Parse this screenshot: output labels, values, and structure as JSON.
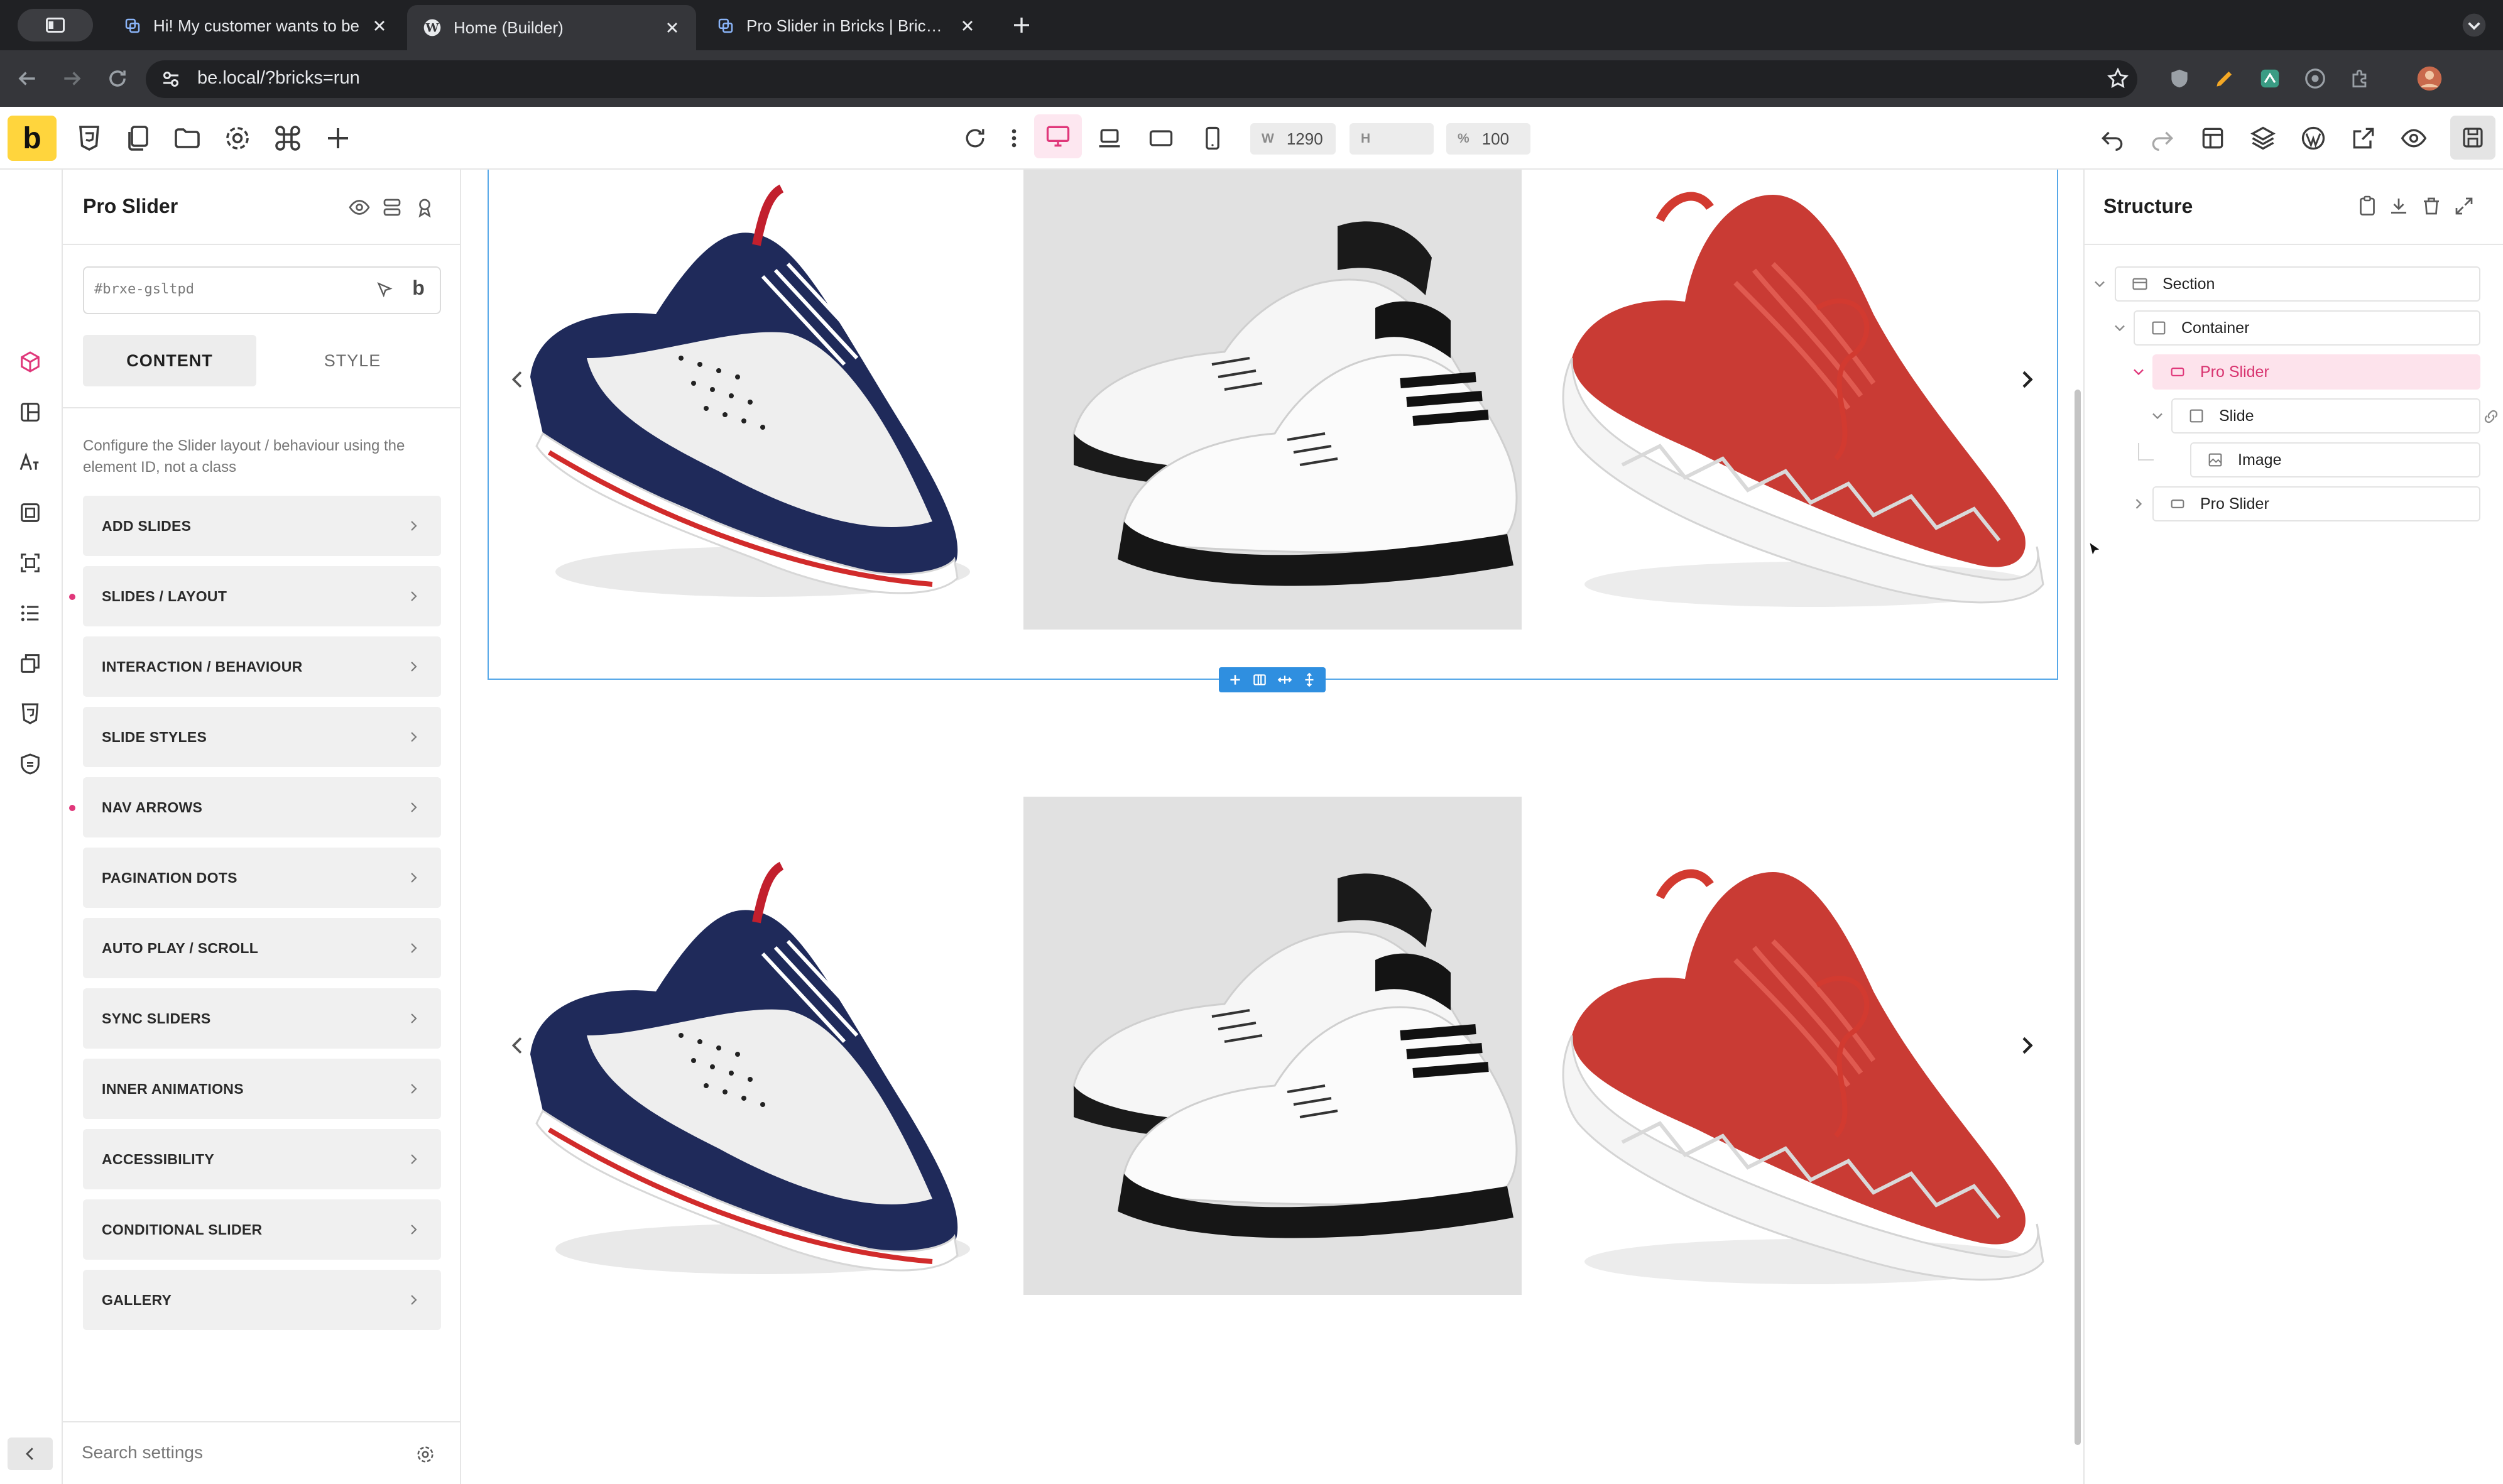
{
  "browser": {
    "tabs": [
      {
        "title": "Hi! My customer wants to be",
        "active": false
      },
      {
        "title": "Home (Builder)",
        "active": true
      },
      {
        "title": "Pro Slider in Bricks | BricksEx",
        "active": false
      }
    ],
    "url": "be.local/?bricks=run"
  },
  "toolbar": {
    "logo_letter": "b",
    "width_label": "W",
    "width_value": "1290",
    "height_label": "H",
    "height_value": "",
    "zoom_label": "%",
    "zoom_value": "100"
  },
  "panel": {
    "title": "Pro Slider",
    "element_id_placeholder": "#brxe-gsltpd",
    "tab_content": "CONTENT",
    "tab_style": "STYLE",
    "description": "Configure the Slider layout / behaviour using the element ID, not a class",
    "sections": [
      {
        "label": "ADD SLIDES",
        "modified": false
      },
      {
        "label": "SLIDES / LAYOUT",
        "modified": true
      },
      {
        "label": "INTERACTION / BEHAVIOUR",
        "modified": false
      },
      {
        "label": "SLIDE STYLES",
        "modified": false
      },
      {
        "label": "NAV ARROWS",
        "modified": true
      },
      {
        "label": "PAGINATION DOTS",
        "modified": false
      },
      {
        "label": "AUTO PLAY / SCROLL",
        "modified": false
      },
      {
        "label": "SYNC SLIDERS",
        "modified": false
      },
      {
        "label": "INNER ANIMATIONS",
        "modified": false
      },
      {
        "label": "ACCESSIBILITY",
        "modified": false
      },
      {
        "label": "CONDITIONAL SLIDER",
        "modified": false
      },
      {
        "label": "GALLERY",
        "modified": false
      }
    ],
    "search_placeholder": "Search settings"
  },
  "structure": {
    "title": "Structure",
    "nodes": [
      {
        "label": "Section",
        "icon": "section-icon",
        "level": 0,
        "expanded": true,
        "active": false
      },
      {
        "label": "Container",
        "icon": "container-icon",
        "level": 1,
        "expanded": true,
        "active": false
      },
      {
        "label": "Pro Slider",
        "icon": "slider-icon",
        "level": 2,
        "expanded": true,
        "active": true
      },
      {
        "label": "Slide",
        "icon": "container-icon",
        "level": 3,
        "expanded": true,
        "active": false
      },
      {
        "label": "Image",
        "icon": "image-icon",
        "level": 4,
        "expanded": false,
        "active": false
      },
      {
        "label": "Pro Slider",
        "icon": "slider-icon",
        "level": 2,
        "expanded": false,
        "active": false
      }
    ]
  },
  "colors": {
    "accent_pink": "#e0377a",
    "selection_blue": "#2f8fe0",
    "logo_yellow": "#ffd53d"
  }
}
